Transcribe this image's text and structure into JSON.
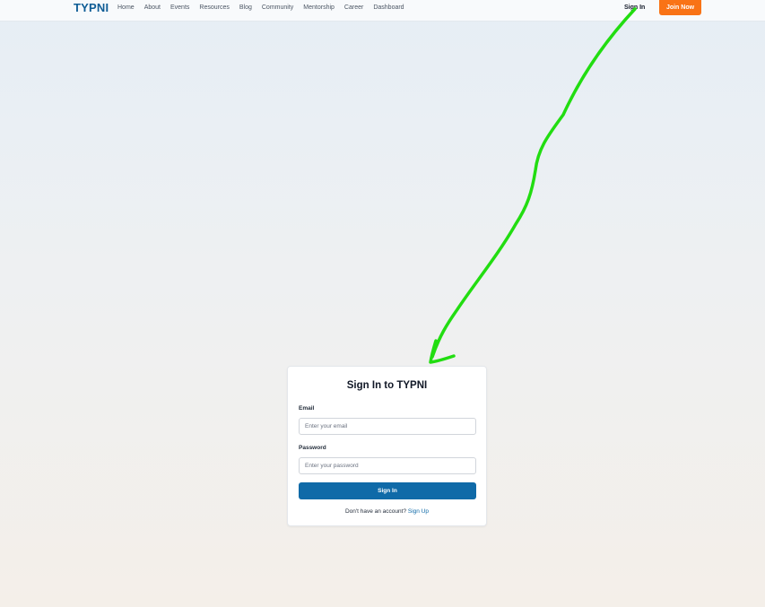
{
  "header": {
    "logo": "TYPNI",
    "nav": [
      "Home",
      "About",
      "Events",
      "Resources",
      "Blog",
      "Community",
      "Mentorship",
      "Career",
      "Dashboard"
    ],
    "sign_in": "Sign In",
    "join": "Join Now"
  },
  "signin_form": {
    "title": "Sign In to TYPNI",
    "email_label": "Email",
    "email_placeholder": "Enter your email",
    "password_label": "Password",
    "password_placeholder": "Enter your password",
    "submit": "Sign In",
    "footer_prompt": "Don't have an account?",
    "footer_link": "Sign Up"
  },
  "colors": {
    "brand": "#0f5d96",
    "primary_button": "#0f6aa8",
    "join_button": "#f97316",
    "annotation": "#22dd11"
  }
}
